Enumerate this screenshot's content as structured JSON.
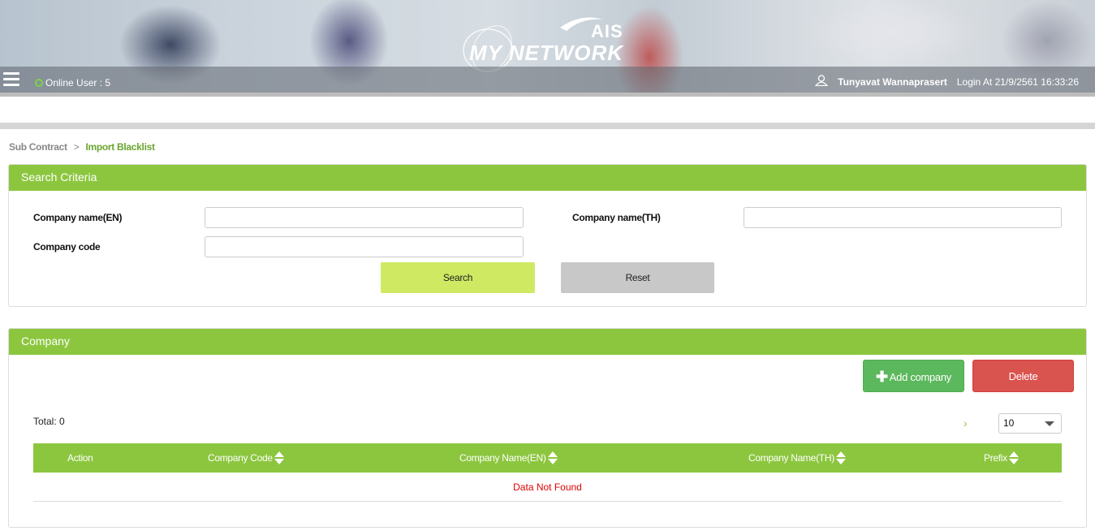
{
  "header": {
    "logo_brand": "AIS",
    "logo_product": "MY NETWORK",
    "online_label": "Online User : 5",
    "user_name": "Tunyavat Wannaprasert",
    "login_text": "Login At 21/9/2561 16:33:26"
  },
  "breadcrumb": {
    "parent": "Sub Contract",
    "separator": ">",
    "current": "Import Blacklist"
  },
  "search_panel": {
    "title": "Search Criteria",
    "company_name_en_label": "Company name(EN)",
    "company_name_en_value": "",
    "company_name_th_label": "Company name(TH)",
    "company_name_th_value": "",
    "company_code_label": "Company code",
    "company_code_value": "",
    "search_button": "Search",
    "reset_button": "Reset"
  },
  "company_panel": {
    "title": "Company",
    "add_button_icon": "plus-icon",
    "add_button": "Add company",
    "delete_button": "Delete",
    "total": "Total: 0",
    "next_page": "›",
    "page_size": "10",
    "columns": [
      "Action",
      "Company Code",
      "Company Name(EN)",
      "Company Name(TH)",
      "Prefix"
    ],
    "empty_message": "Data Not Found"
  },
  "colors": {
    "accent_green": "#8cc63f",
    "search_button": "#cfea62",
    "add_button": "#5cb85c",
    "delete_button": "#d9534f",
    "error_text": "#dd0000"
  }
}
